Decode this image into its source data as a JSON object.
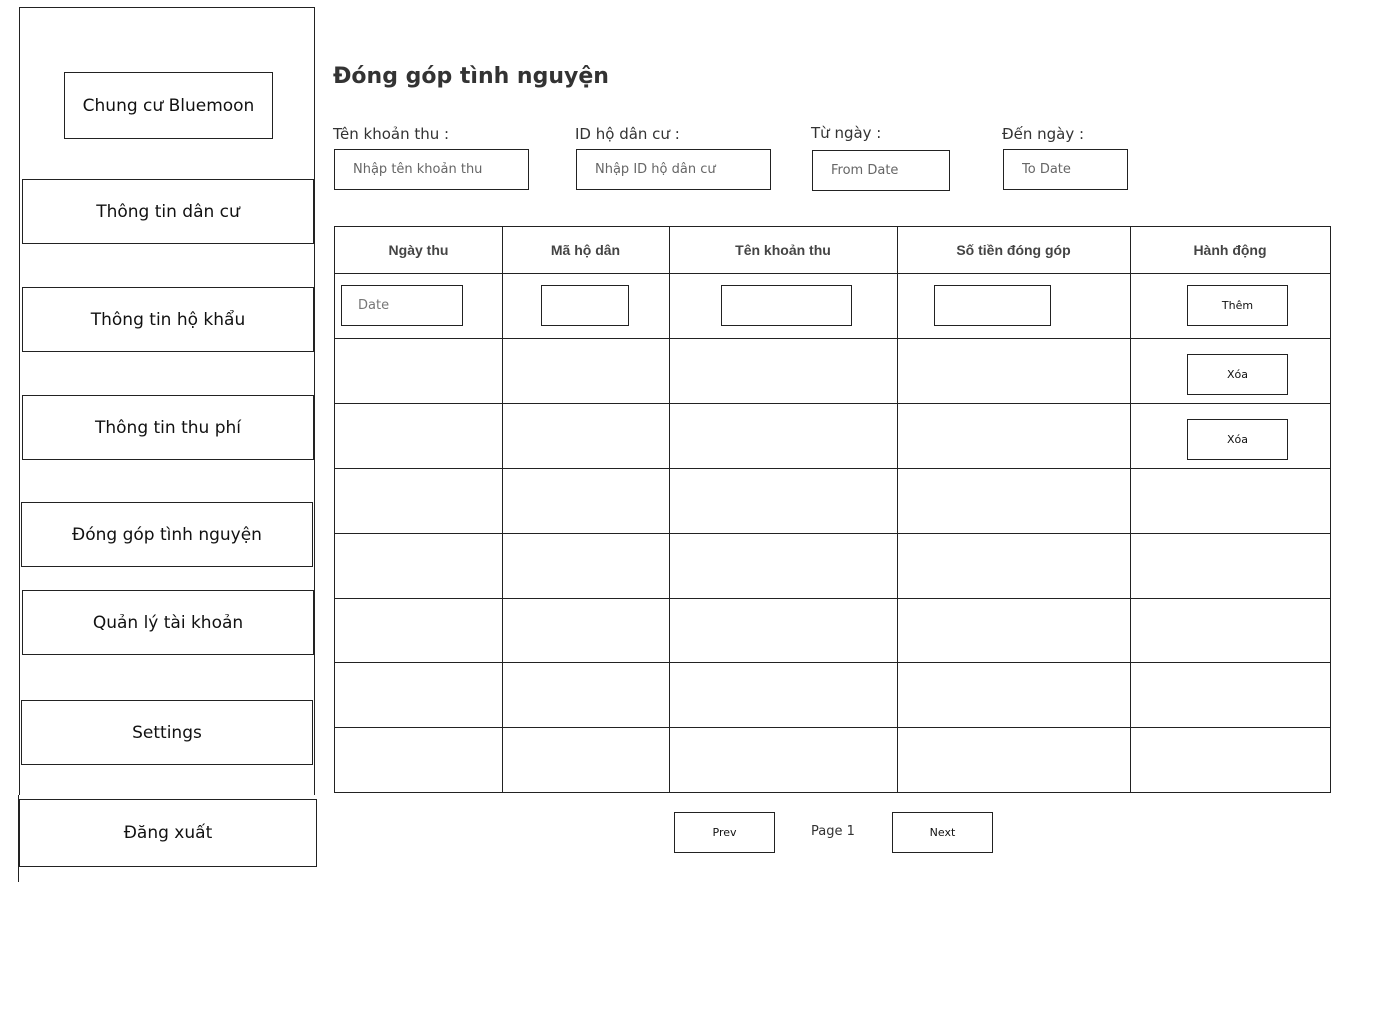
{
  "sidebar": {
    "brand": "Chung cư Bluemoon",
    "items": [
      {
        "label": "Thông tin dân cư"
      },
      {
        "label": "Thông tin hộ khẩu"
      },
      {
        "label": "Thông tin thu phí"
      },
      {
        "label": "Đóng góp tình nguyện"
      },
      {
        "label": "Quản lý tài khoản"
      },
      {
        "label": "Settings"
      }
    ],
    "logout": "Đăng xuất"
  },
  "page": {
    "title": "Đóng góp tình nguyện"
  },
  "filters": {
    "fee_name": {
      "label": "Tên khoản thu :",
      "placeholder": "Nhập tên khoản thu"
    },
    "household_id": {
      "label": "ID hộ dân cư :",
      "placeholder": "Nhập ID hộ dân cư"
    },
    "from_date": {
      "label": "Từ ngày :",
      "placeholder": "From Date"
    },
    "to_date": {
      "label": "Đến ngày :",
      "placeholder": "To Date"
    }
  },
  "table": {
    "headers": [
      "Ngày thu",
      "Mã hộ dân",
      "Tên khoản thu",
      "Số tiền đóng góp",
      "Hành động"
    ],
    "input_row": {
      "date_placeholder": "Date",
      "add_button": "Thêm"
    },
    "rows": [
      {
        "action": "Xóa"
      },
      {
        "action": "Xóa"
      },
      {
        "action": ""
      },
      {
        "action": ""
      },
      {
        "action": ""
      },
      {
        "action": ""
      },
      {
        "action": ""
      }
    ]
  },
  "pagination": {
    "prev": "Prev",
    "page_label": "Page 1",
    "next": "Next"
  }
}
